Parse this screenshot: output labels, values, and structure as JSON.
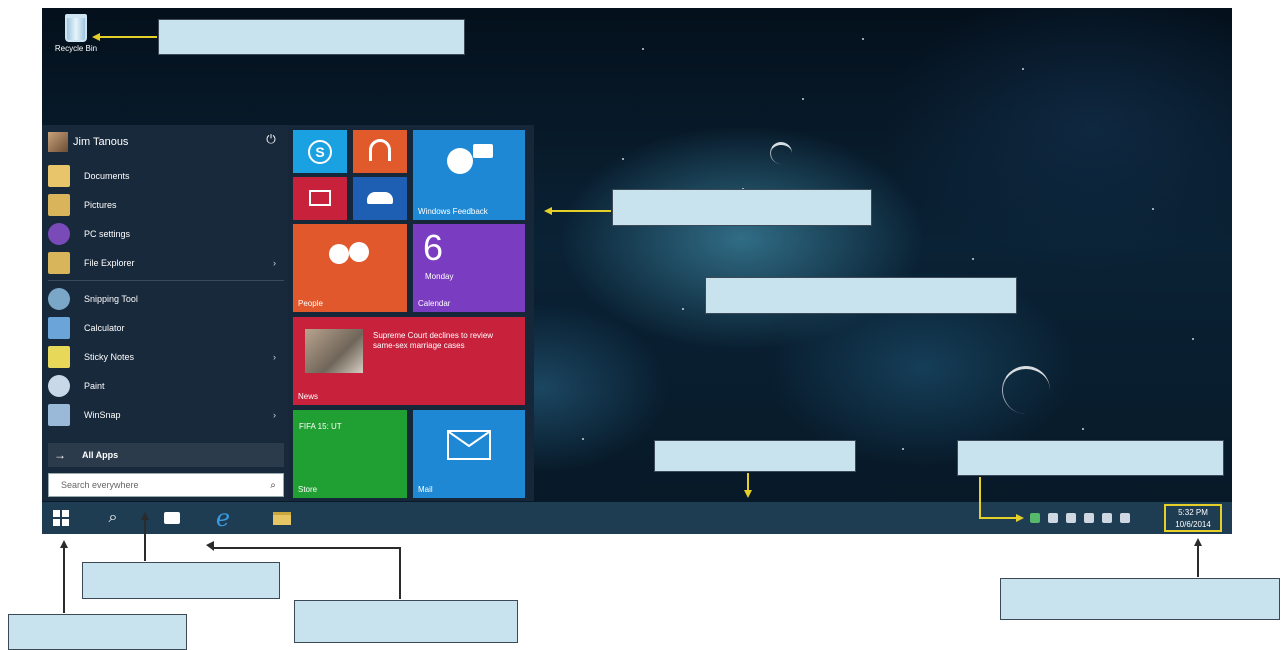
{
  "desktop": {
    "recycle_bin_label": "Recycle Bin"
  },
  "start_menu": {
    "user_name": "Jim Tanous",
    "power_glyph": "⏻",
    "items": [
      {
        "label": "Documents",
        "icon": "folder-icon",
        "color": "#e8c46a"
      },
      {
        "label": "Pictures",
        "icon": "pictures-icon",
        "color": "#d9b45a"
      },
      {
        "label": "PC settings",
        "icon": "gear-icon",
        "color": "#7a4ab8"
      },
      {
        "label": "File Explorer",
        "icon": "file-explorer-icon",
        "color": "#d8b45a",
        "chevron": "›"
      },
      {
        "label": "Snipping Tool",
        "icon": "scissors-icon",
        "color": "#7aa6c8"
      },
      {
        "label": "Calculator",
        "icon": "calculator-icon",
        "color": "#6aa4d8"
      },
      {
        "label": "Sticky Notes",
        "icon": "sticky-notes-icon",
        "color": "#e8d85a",
        "chevron": "›"
      },
      {
        "label": "Paint",
        "icon": "paint-icon",
        "color": "#c8d8e8"
      },
      {
        "label": "WinSnap",
        "icon": "winsnap-icon",
        "color": "#9ab8d8",
        "chevron": "›"
      }
    ],
    "all_apps": "All Apps",
    "all_apps_arrow": "→",
    "search_placeholder": "Search everywhere",
    "search_glyph": "⌕"
  },
  "tiles": {
    "windows_feedback": "Windows Feedback",
    "people": "People",
    "calendar_day": "6",
    "calendar_weekday": "Monday",
    "calendar": "Calendar",
    "news_headline": "Supreme Court declines to review same-sex marriage cases",
    "news": "News",
    "store_game": "FIFA 15: UT",
    "store": "Store",
    "mail": "Mail",
    "colors": {
      "skype": "#1aa1e1",
      "music": "#e05a2b",
      "video": "#c8213c",
      "onedrive": "#1f5fb3",
      "feedback": "#1e88d4",
      "people": "#e0582b",
      "calendar": "#7a3cc0",
      "news": "#c8213c",
      "store": "#20a032",
      "mail": "#1e88d4"
    }
  },
  "taskbar": {
    "time": "5:32 PM",
    "date": "10/6/2014",
    "ie_glyph": "e",
    "search_glyph": "⌕"
  }
}
